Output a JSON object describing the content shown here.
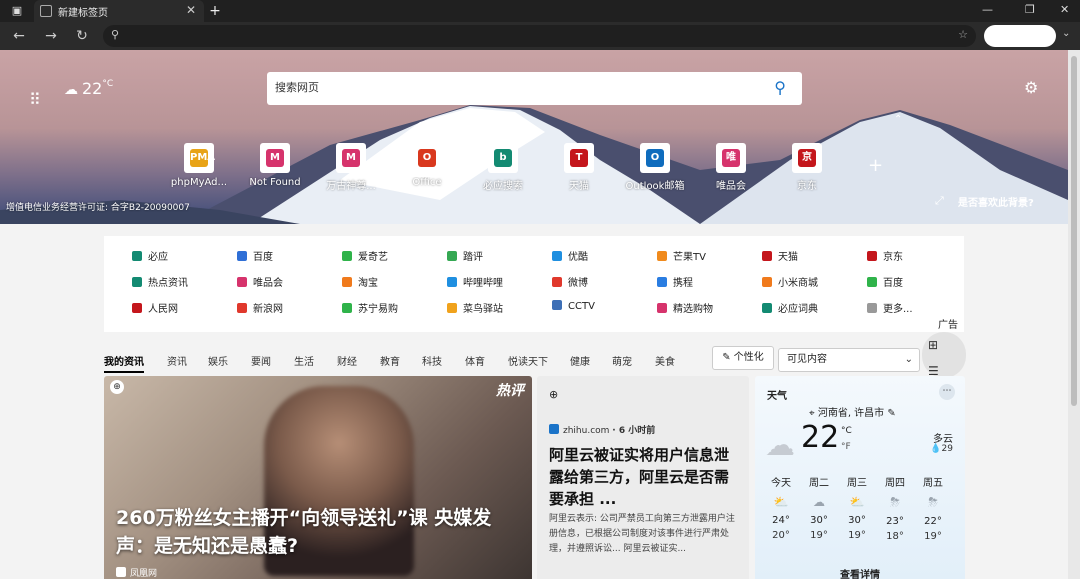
{
  "tab": {
    "title": "新建标签页"
  },
  "address": {
    "value": "",
    "placeholder": ""
  },
  "weather_mini": {
    "temp": "22",
    "unit": "°C"
  },
  "search": {
    "placeholder": "搜索网页"
  },
  "quicklinks": [
    {
      "label": "phpMyAd...",
      "color": "#e8a317",
      "glyph": "PMA"
    },
    {
      "label": "Not Found",
      "color": "#d6336c",
      "glyph": "M"
    },
    {
      "label": "万古神尊...",
      "color": "#d6336c",
      "glyph": "M"
    },
    {
      "label": "Office",
      "color": "#d9381e",
      "glyph": "O"
    },
    {
      "label": "必应搜索",
      "color": "#138a72",
      "glyph": "b"
    },
    {
      "label": "天猫",
      "color": "#c4161c",
      "glyph": "T"
    },
    {
      "label": "Outlook邮箱",
      "color": "#0f6cbd",
      "glyph": "O"
    },
    {
      "label": "唯品会",
      "color": "#d6336c",
      "glyph": "唯"
    },
    {
      "label": "京东",
      "color": "#c4161c",
      "glyph": "京"
    }
  ],
  "icp": "增值电信业务经营许可证: 合字B2-20090007",
  "like_bg": "是否喜欢此背景?",
  "links": [
    [
      {
        "label": "必应",
        "color": "#138a72"
      },
      {
        "label": "百度",
        "color": "#2f6fd6"
      },
      {
        "label": "爱奇艺",
        "color": "#2fb34a"
      },
      {
        "label": "踏评",
        "color": "#35a853"
      },
      {
        "label": "优酷",
        "color": "#1f8fe0"
      },
      {
        "label": "芒果TV",
        "color": "#f08a1c"
      },
      {
        "label": "天猫",
        "color": "#c4161c"
      },
      {
        "label": "京东",
        "color": "#c4161c"
      }
    ],
    [
      {
        "label": "热点资讯",
        "color": "#138a72"
      },
      {
        "label": "唯品会",
        "color": "#d6336c"
      },
      {
        "label": "淘宝",
        "color": "#f07a1c"
      },
      {
        "label": "哔哩哔哩",
        "color": "#1f8fe0"
      },
      {
        "label": "微博",
        "color": "#e0382c"
      },
      {
        "label": "携程",
        "color": "#2a7de1"
      },
      {
        "label": "小米商城",
        "color": "#f07a1c"
      },
      {
        "label": "百度",
        "color": "#2fb34a"
      }
    ],
    [
      {
        "label": "人民网",
        "color": "#c4161c"
      },
      {
        "label": "新浪网",
        "color": "#e0382c"
      },
      {
        "label": "苏宁易购",
        "color": "#2fb34a"
      },
      {
        "label": "菜鸟驿站",
        "color": "#f0a21c"
      },
      {
        "label": "CCTV",
        "color": "#3d6fb6"
      },
      {
        "label": "精选购物",
        "color": "#d6336c"
      },
      {
        "label": "必应词典",
        "color": "#138a72"
      },
      {
        "label": "更多...",
        "color": "#999999"
      }
    ]
  ],
  "ad_label": "广告",
  "feed_tabs": [
    "我的资讯",
    "资讯",
    "娱乐",
    "要闻",
    "生活",
    "财经",
    "教育",
    "科技",
    "体育",
    "悦读天下",
    "健康",
    "萌宠",
    "美食"
  ],
  "personalize": "个性化",
  "visible_content": "可见内容",
  "main_card": {
    "badge": "热评",
    "headline": "260万粉丝女主播开“向领导送礼”课 央媒发声：是无知还是愚蠢?",
    "source": "凤凰网"
  },
  "news_card": {
    "source": "zhihu.com",
    "time": "· 6 小时前",
    "headline": "阿里云被证实将用户信息泄露给第三方，阿里云是否需要承担 ...",
    "snippet": "阿里云表示: 公司严禁员工向第三方泄露用户注册信息，已根据公司制度对该事件进行严肃处理，并遵照诉讼... 阿里云被证实..."
  },
  "weather": {
    "title": "天气",
    "location": "河南省, 许昌市",
    "temp": "22",
    "unit_c": "°C",
    "unit_f": "°F",
    "condition": "多云",
    "rain": "29",
    "days": [
      {
        "name": "今天",
        "hi": "24°",
        "lo": "20°"
      },
      {
        "name": "周二",
        "hi": "30°",
        "lo": "19°"
      },
      {
        "name": "周三",
        "hi": "30°",
        "lo": "19°"
      },
      {
        "name": "周四",
        "hi": "23°",
        "lo": "18°"
      },
      {
        "name": "周五",
        "hi": "22°",
        "lo": "19°"
      }
    ],
    "details": "查看详情"
  }
}
